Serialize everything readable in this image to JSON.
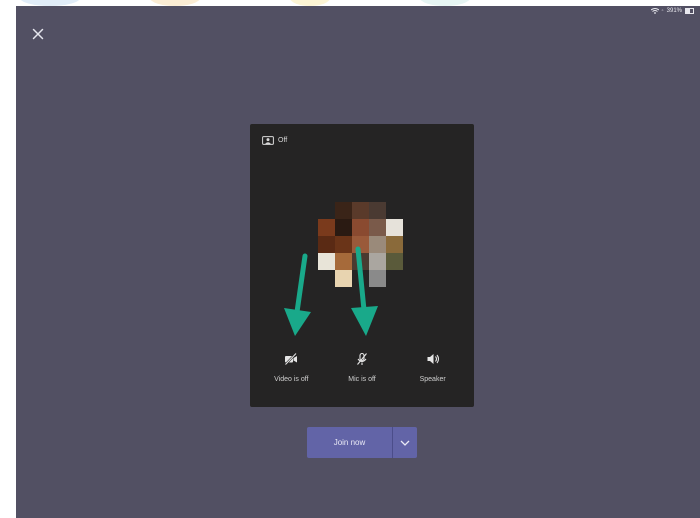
{
  "status_bar": {
    "battery": "391%"
  },
  "preview": {
    "background_effects_label": "Off"
  },
  "controls": [
    {
      "label": "Video is off",
      "icon": "video-off-icon"
    },
    {
      "label": "Mic is off",
      "icon": "mic-off-icon"
    },
    {
      "label": "Speaker",
      "icon": "speaker-icon"
    }
  ],
  "join": {
    "label": "Join now",
    "dropdown_icon": "chevron-down-icon"
  },
  "colors": {
    "screen_bg": "#525063",
    "card_bg": "#252424",
    "accent": "#6264a7",
    "arrow": "#19a98a"
  }
}
